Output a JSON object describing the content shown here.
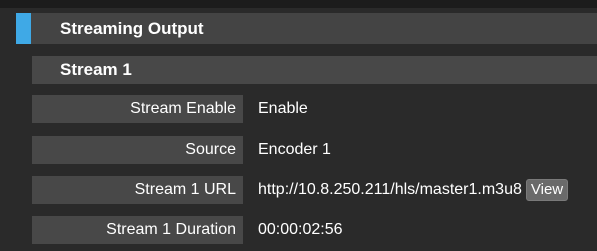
{
  "colors": {
    "background": "#2a2a2a",
    "header_bg": "#444444",
    "label_bg": "#484848",
    "accent": "#3fa9e6",
    "button_bg": "#6a6a6a"
  },
  "section": {
    "title": "Streaming Output"
  },
  "stream": {
    "title": "Stream 1",
    "rows": [
      {
        "label": "Stream Enable",
        "value": "Enable"
      },
      {
        "label": "Source",
        "value": "Encoder 1"
      },
      {
        "label": "Stream 1 URL",
        "value": "http://10.8.250.211/hls/master1.m3u8",
        "button": "View"
      },
      {
        "label": "Stream 1 Duration",
        "value": "00:00:02:56"
      }
    ]
  }
}
